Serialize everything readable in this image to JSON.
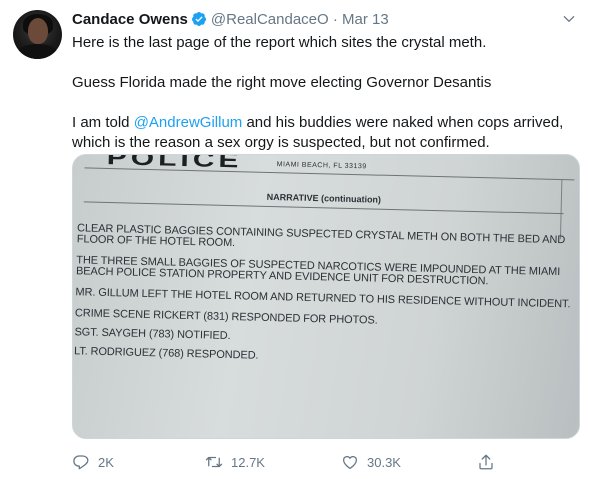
{
  "author": {
    "name": "Candace Owens",
    "handle": "@RealCandaceO",
    "separator": "·",
    "date": "Mar 13"
  },
  "tweet": {
    "line1": "Here is the last page of the report which sites the crystal meth.",
    "line2": "Guess Florida made the right move electing Governor Desantis",
    "line3_prefix": "I am told ",
    "line3_mention": "@AndrewGillum",
    "line3_suffix": " and his buddies were naked when cops arrived, which is the reason a sex orgy is suspected, but not confirmed."
  },
  "media": {
    "header_word": "POLICE",
    "address": "MIAMI BEACH, FL 33139",
    "section_title": "NARRATIVE (continuation)",
    "paragraphs": [
      "CLEAR PLASTIC BAGGIES CONTAINING SUSPECTED CRYSTAL METH ON BOTH THE BED AND FLOOR OF THE HOTEL ROOM.",
      "THE THREE SMALL BAGGIES OF SUSPECTED NARCOTICS WERE IMPOUNDED AT THE MIAMI BEACH POLICE STATION PROPERTY AND EVIDENCE UNIT FOR DESTRUCTION.",
      "MR. GILLUM LEFT THE HOTEL ROOM AND RETURNED TO HIS RESIDENCE WITHOUT INCIDENT.",
      "CRIME SCENE RICKERT (831) RESPONDED FOR PHOTOS.",
      "SGT. SAYGEH (783) NOTIFIED.",
      "LT. RODRIGUEZ (768) RESPONDED."
    ]
  },
  "actions": {
    "replies": "2K",
    "retweets": "12.7K",
    "likes": "30.3K"
  },
  "icons": {
    "verified": "verified-badge-icon",
    "more": "chevron-down-icon",
    "reply": "reply-icon",
    "retweet": "retweet-icon",
    "like": "heart-icon",
    "share": "share-icon"
  },
  "colors": {
    "accent": "#1da1f2",
    "muted": "#657786",
    "text": "#14171a"
  }
}
